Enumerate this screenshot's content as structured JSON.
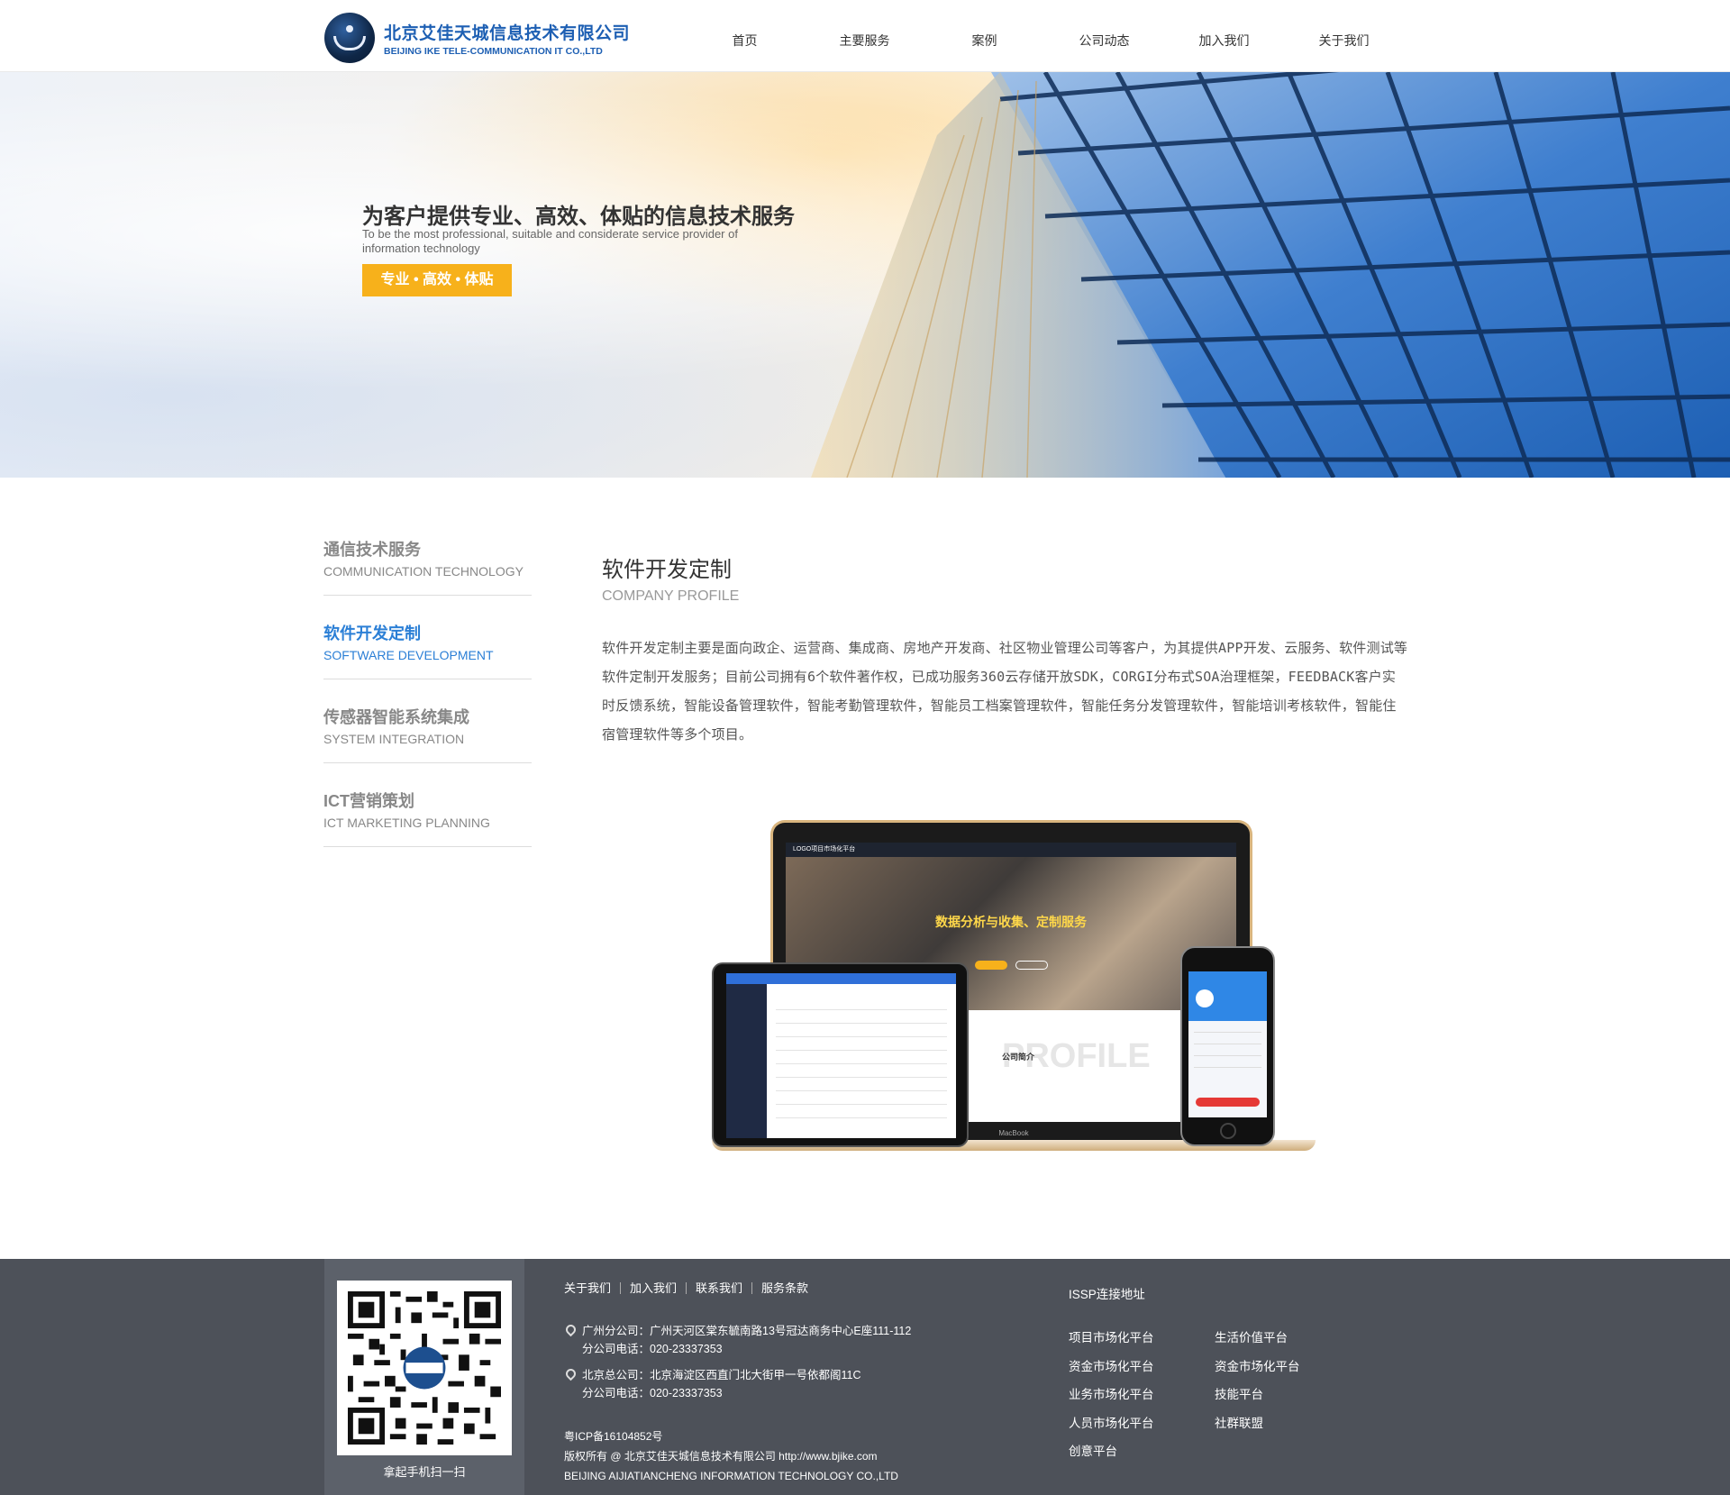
{
  "header": {
    "logo_cn": "北京艾佳天城信息技术有限公司",
    "logo_en": "BEIJING IKE TELE-COMMUNICATION IT CO.,LTD",
    "nav": [
      "首页",
      "主要服务",
      "案例",
      "公司动态",
      "加入我们",
      "关于我们"
    ]
  },
  "hero": {
    "title": "为客户提供专业、高效、体贴的信息技术服务",
    "subtitle": "To be the most professional, suitable and considerate service provider of information technology",
    "button": "专业 • 高效 • 体贴"
  },
  "sidebar": {
    "items": [
      {
        "cn": "通信技术服务",
        "en": "COMMUNICATION TECHNOLOGY",
        "active": false
      },
      {
        "cn": "软件开发定制",
        "en": "SOFTWARE DEVELOPMENT",
        "active": true
      },
      {
        "cn": "传感器智能系统集成",
        "en": "SYSTEM INTEGRATION",
        "active": false
      },
      {
        "cn": "ICT营销策划",
        "en": "ICT MARKETING PLANNING",
        "active": false
      }
    ]
  },
  "content": {
    "title": "软件开发定制",
    "subtitle": "COMPANY PROFILE",
    "text": "软件开发定制主要是面向政企、运营商、集成商、房地产开发商、社区物业管理公司等客户，为其提供APP开发、云服务、软件测试等软件定制开发服务；目前公司拥有6个软件著作权，已成功服务360云存储开放SDK，CORGI分布式SOA治理框架，FEEDBACK客户实时反馈系统，智能设备管理软件，智能考勤管理软件，智能员工档案管理软件，智能任务分发管理软件，智能培训考核软件，智能住宿管理软件等多个项目。"
  },
  "mockup": {
    "laptop_bar": "LOGO项目市场化平台",
    "laptop_hero_title": "数据分析与收集、定制服务",
    "laptop_profile": "PROFILE",
    "laptop_company": "公司简介",
    "laptop_brand": "MacBook"
  },
  "footer": {
    "qr_caption": "拿起手机扫一扫",
    "links": [
      "关于我们",
      "加入我们",
      "联系我们",
      "服务条款"
    ],
    "addresses": [
      {
        "line1": "广州分公司：广州天河区棠东毓南路13号冠达商务中心E座111-112",
        "line2": "分公司电话：020-23337353"
      },
      {
        "line1": "北京总公司：北京海淀区西直门北大街甲一号依都阁11C",
        "line2": "分公司电话：020-23337353"
      }
    ],
    "icp": "粤ICP备16104852号",
    "copyright": "版权所有 @ 北京艾佳天城信息技术有限公司 http://www.bjike.com",
    "company_en": "BEIJING AIJIATIANCHENG INFORMATION TECHNOLOGY CO.,LTD",
    "issp_title": "ISSP连接地址",
    "issp_col1": [
      "项目市场化平台",
      "资金市场化平台",
      "业务市场化平台",
      "人员市场化平台",
      "创意平台"
    ],
    "issp_col2": [
      "生活价值平台",
      "资金市场化平台",
      "技能平台",
      "社群联盟"
    ]
  },
  "colors": {
    "accent": "#2b7fd6",
    "button": "#f7b11b",
    "footer_bg": "#4d5159"
  }
}
